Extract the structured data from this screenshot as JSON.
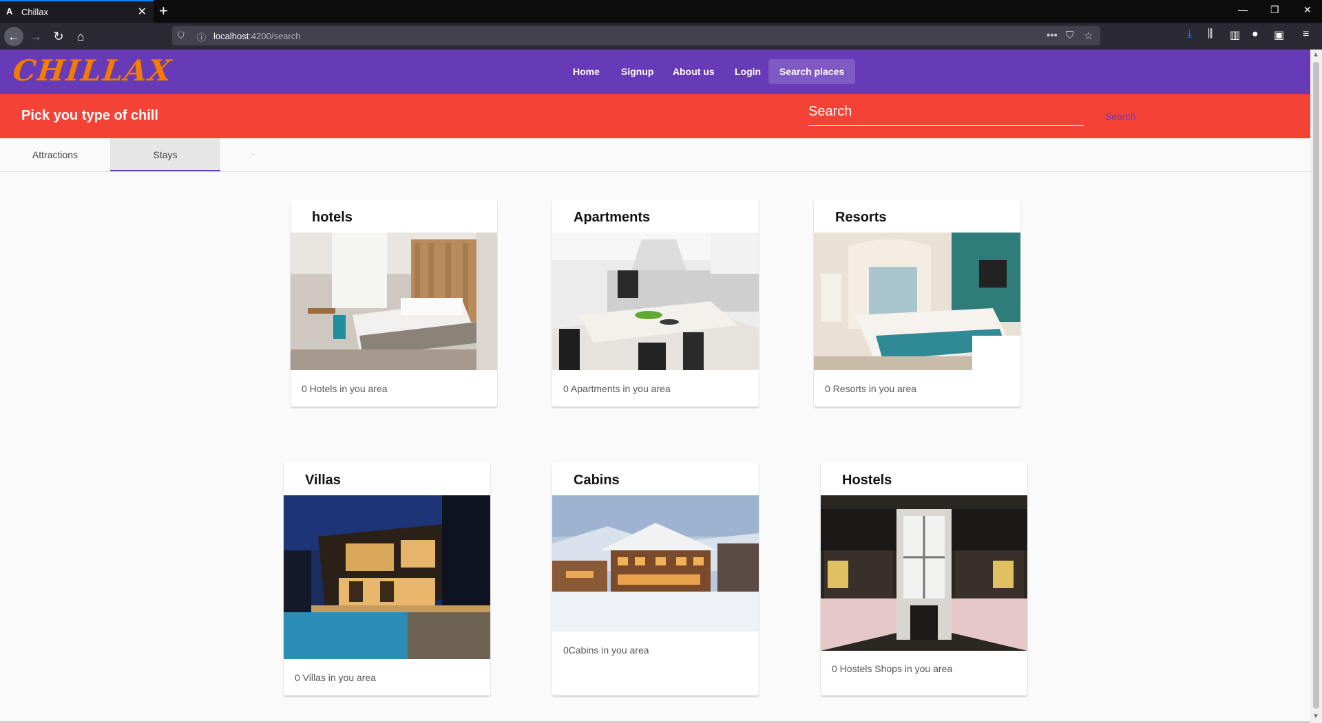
{
  "browser": {
    "tab_title": "Chillax",
    "favicon": "A",
    "url_host": "localhost",
    "url_path": ":4200/search"
  },
  "app": {
    "logo": "CHILLAX",
    "nav": [
      "Home",
      "Signup",
      "About us",
      "Login",
      "Search places"
    ],
    "banner_title": "Pick you type of chill",
    "search_placeholder": "Search",
    "search_button": "Search",
    "tabs": [
      "Attractions",
      "Stays"
    ],
    "active_tab": "Stays"
  },
  "cards": [
    {
      "title": "hotels",
      "text": "0 Hotels in you area"
    },
    {
      "title": "Apartments",
      "text": "0 Apartments in you area"
    },
    {
      "title": "Resorts",
      "text": "0 Resorts in you area"
    },
    {
      "title": "Villas",
      "text": "0 Villas in you area"
    },
    {
      "title": "Cabins",
      "text": "0Cabins in you area"
    },
    {
      "title": "Hostels",
      "text": "0 Hostels Shops in you area"
    }
  ],
  "colors": {
    "header": "#673ab7",
    "banner": "#f44336",
    "logo": "#f57c00"
  }
}
